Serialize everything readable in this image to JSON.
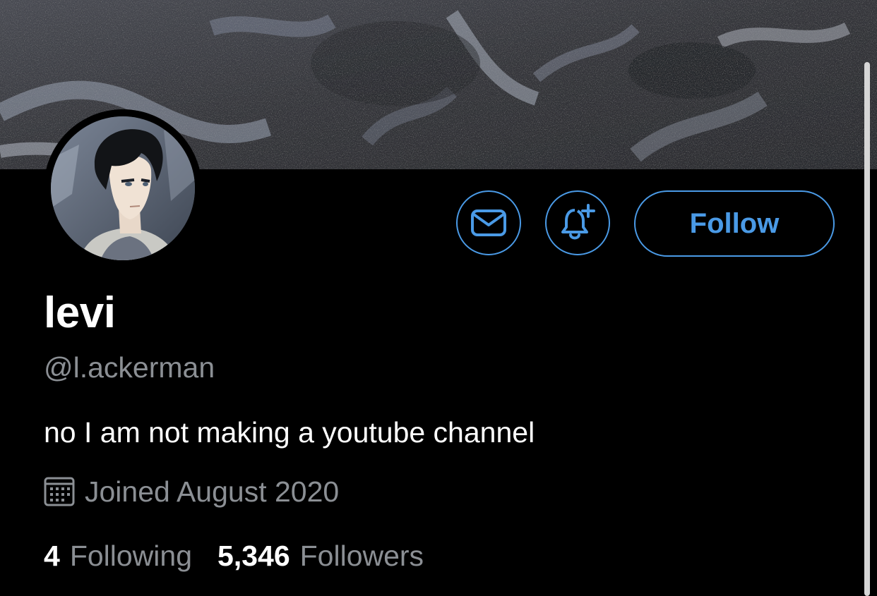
{
  "profile": {
    "display_name": "levi",
    "handle": "@l.ackerman",
    "bio": "no I am not making a youtube channel",
    "joined": "Joined August 2020",
    "following_count": "4",
    "following_label": "Following",
    "followers_count": "5,346",
    "followers_label": "Followers"
  },
  "actions": {
    "follow_label": "Follow",
    "message_icon": "envelope-icon",
    "notify_icon": "bell-plus-icon"
  },
  "icons": {
    "joined": "calendar-icon"
  },
  "colors": {
    "accent": "#4a9ae6",
    "background": "#000000",
    "primary_text": "#ffffff",
    "secondary_text": "#8b8f94"
  }
}
